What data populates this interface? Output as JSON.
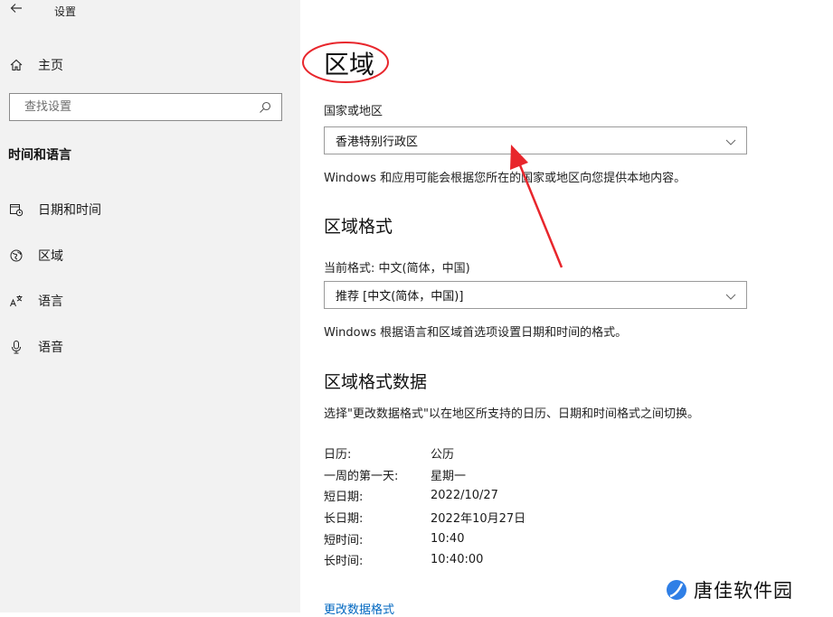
{
  "app": {
    "title": "设置",
    "back_icon": "back-arrow-icon"
  },
  "sidebar": {
    "home_label": "主页",
    "search_placeholder": "查找设置",
    "section_label": "时间和语言",
    "items": [
      {
        "label": "日期和时间",
        "icon": "calendar-clock-icon"
      },
      {
        "label": "区域",
        "icon": "globe-region-icon"
      },
      {
        "label": "语言",
        "icon": "language-icon"
      },
      {
        "label": "语音",
        "icon": "microphone-icon"
      }
    ]
  },
  "main": {
    "title": "区域",
    "country_label": "国家或地区",
    "country_value": "香港特别行政区",
    "country_desc": "Windows 和应用可能会根据您所在的国家或地区向您提供本地内容。",
    "format_heading": "区域格式",
    "current_format": "当前格式: 中文(简体，中国)",
    "format_value": "推荐 [中文(简体，中国)]",
    "format_desc": "Windows 根据语言和区域首选项设置日期和时间的格式。",
    "data_heading": "区域格式数据",
    "data_desc": "选择\"更改数据格式\"以在地区所支持的日历、日期和时间格式之间切换。",
    "data_rows": [
      {
        "key": "日历:",
        "value": "公历"
      },
      {
        "key": "一周的第一天:",
        "value": "星期一"
      },
      {
        "key": "短日期:",
        "value": "2022/10/27"
      },
      {
        "key": "长日期:",
        "value": "2022年10月27日"
      },
      {
        "key": "短时间:",
        "value": "10:40"
      },
      {
        "key": "长时间:",
        "value": "10:40:00"
      }
    ],
    "change_link": "更改数据格式"
  },
  "watermark": {
    "text": "唐佳软件园"
  },
  "colors": {
    "annotation_red": "#e8262c",
    "link_blue": "#0067c0",
    "sidebar_bg": "#f2f2f2"
  }
}
